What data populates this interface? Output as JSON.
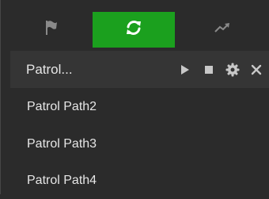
{
  "tabs": [
    {
      "icon": "flag-icon",
      "active": false
    },
    {
      "icon": "refresh-icon",
      "active": true
    },
    {
      "icon": "trend-icon",
      "active": false
    }
  ],
  "current_path": {
    "label": "Patrol..."
  },
  "paths": [
    {
      "label": "Patrol Path2"
    },
    {
      "label": "Patrol Path3"
    },
    {
      "label": "Patrol Path4"
    }
  ],
  "colors": {
    "accent": "#1ba01e",
    "background": "#2b2b2b",
    "header_row": "#353535",
    "text": "#e6e6e6"
  }
}
